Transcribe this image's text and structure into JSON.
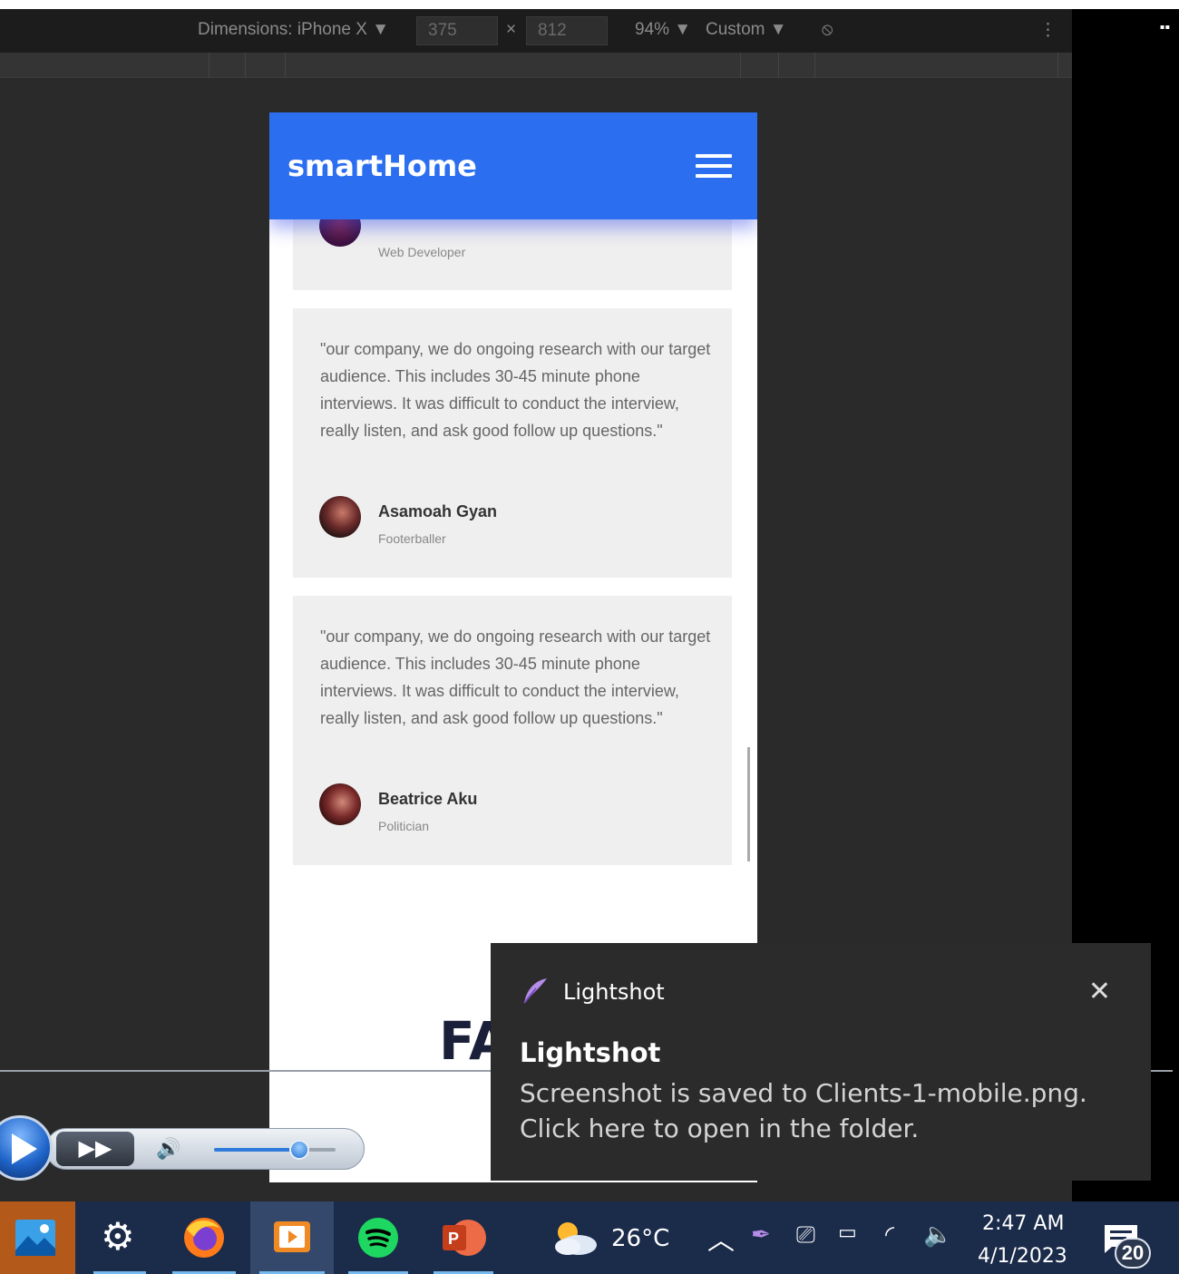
{
  "devtools": {
    "dimensions_label": "Dimensions: iPhone X ▼",
    "width_value": "375",
    "times": "×",
    "height_value": "812",
    "zoom": "94% ▼",
    "throttle": "Custom ▼",
    "more": "⋮"
  },
  "phone": {
    "brand": "smartHome",
    "partial_role": "Web Developer",
    "testimonials": [
      {
        "quote": "\"our company, we do ongoing research with our target audience. This includes 30-45 minute phone interviews. It was difficult to conduct the interview, really listen, and ask good follow up questions.\"",
        "name": "Asamoah Gyan",
        "role": "Footerballer"
      },
      {
        "quote": "\"our company, we do ongoing research with our target audience. This includes 30-45 minute phone interviews. It was difficult to conduct the interview, really listen, and ask good follow up questions.\"",
        "name": "Beatrice Aku",
        "role": "Politician"
      }
    ],
    "section_heading": "FA"
  },
  "player": {
    "ffwd": "▶▶",
    "volume_icon": "🔊",
    "volume_level": 0.7
  },
  "toast": {
    "app": "Lightshot",
    "close": "✕",
    "title": "Lightshot",
    "body": "Screenshot is saved to Clients-1-mobile.png. Click here to open in the folder."
  },
  "taskbar": {
    "apps": [
      "photos-icon",
      "settings-icon",
      "firefox-icon",
      "media-player-icon",
      "spotify-icon",
      "powerpoint-icon"
    ],
    "weather_temp": "26°C",
    "tray_chevron": "^",
    "time": "2:47 AM",
    "date": "4/1/2023",
    "notification_count": "20"
  },
  "colors": {
    "brand_blue": "#2b6ef0",
    "taskbar": "#1b2b4a",
    "toast_bg": "#2b2b2b"
  }
}
